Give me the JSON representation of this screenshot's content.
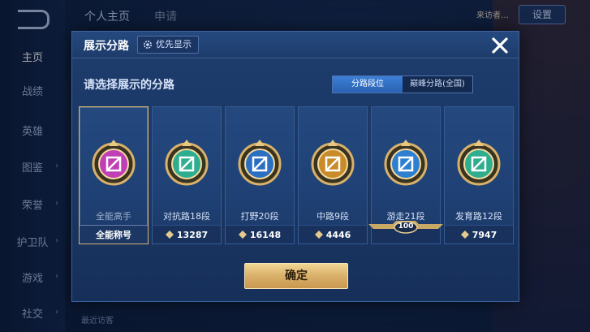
{
  "sidebar": {
    "items": [
      {
        "label": "主页",
        "active": true
      },
      {
        "label": "战绩"
      },
      {
        "label": "英雄"
      },
      {
        "label": "图鉴"
      },
      {
        "label": "荣誉"
      },
      {
        "label": "护卫队"
      },
      {
        "label": "游戏"
      },
      {
        "label": "社交"
      }
    ]
  },
  "top": {
    "tabs": [
      "个人主页",
      "申请"
    ],
    "right_button": "设置",
    "user_name": "来访者…"
  },
  "dialog": {
    "title": "展示分路",
    "priority_label": "优先显示",
    "prompt": "请选择展示的分路",
    "segments": [
      {
        "label": "分路段位",
        "active": true
      },
      {
        "label": "巅峰分路(全国)",
        "active": false
      }
    ],
    "cards": [
      {
        "label": "全能高手",
        "foot": "全能称号",
        "icon": "all-round-emblem",
        "color": "#c03fb5",
        "selected": true
      },
      {
        "label": "对抗路18段",
        "foot": "13287",
        "icon": "clash-lane-emblem",
        "color": "#2fae8f"
      },
      {
        "label": "打野20段",
        "foot": "16148",
        "icon": "jungle-emblem",
        "color": "#2b6fc2"
      },
      {
        "label": "中路9段",
        "foot": "4446",
        "icon": "mid-lane-emblem",
        "color": "#c98a2a"
      },
      {
        "label": "游走21段",
        "foot": "",
        "ribbon": "100",
        "icon": "roam-emblem",
        "color": "#2f7fd0"
      },
      {
        "label": "发育路12段",
        "foot": "7947",
        "icon": "farm-lane-emblem",
        "color": "#2fae8f"
      }
    ],
    "confirm_label": "确定"
  },
  "footer": {
    "text": "最近访客"
  },
  "colors": {
    "gold": "#d9b06a",
    "accent_blue": "#2a62b3",
    "panel": "#1e3d6d"
  }
}
